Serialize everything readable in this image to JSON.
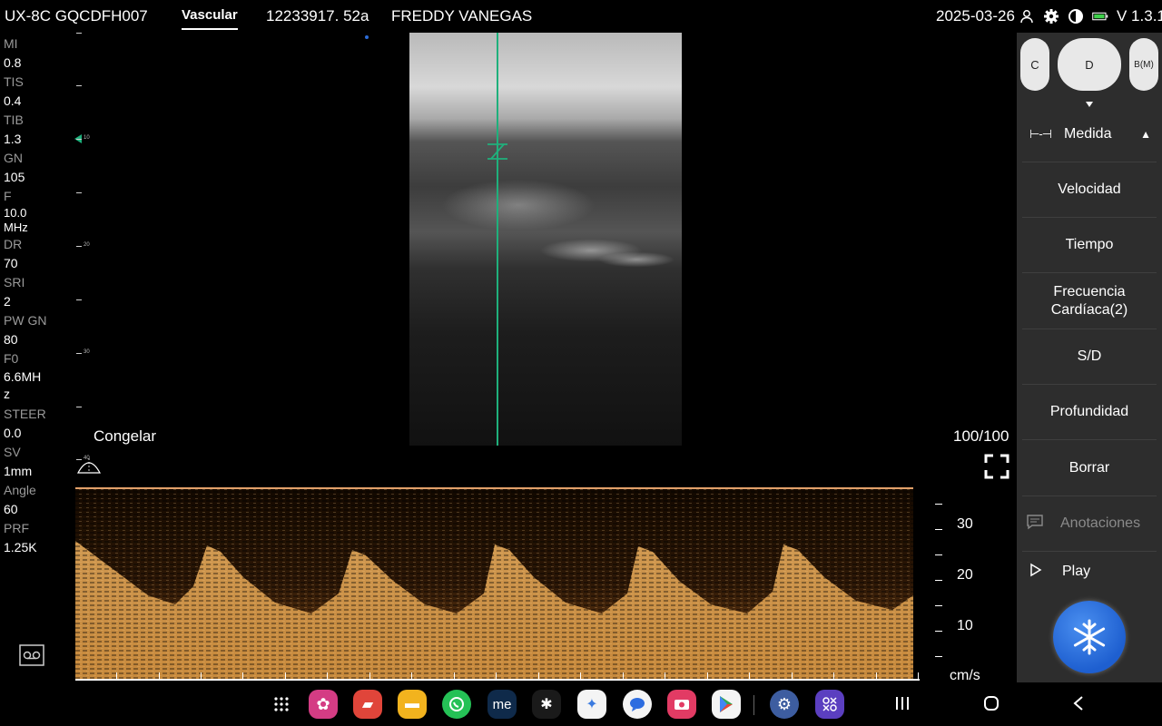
{
  "topbar": {
    "probe": "UX-8C GQCDFH007",
    "tab": "Vascular",
    "patient_id": "12233917. 52a",
    "patient_name": "FREDDY VANEGAS",
    "date": "2025-03-26",
    "version": "V 1.3.1"
  },
  "params": [
    {
      "label": "MI",
      "value": "0.8"
    },
    {
      "label": "TIS",
      "value": "0.4"
    },
    {
      "label": "TIB",
      "value": "1.3"
    },
    {
      "label": "GN",
      "value": "105"
    },
    {
      "label": "F",
      "value": "10.0\nMHz"
    },
    {
      "label": "DR",
      "value": "70"
    },
    {
      "label": "SRI",
      "value": "2"
    },
    {
      "label": "PW GN",
      "value": "80"
    },
    {
      "label": "F0",
      "value": "6.6MH\nz"
    },
    {
      "label": "STEER",
      "value": "0.0"
    },
    {
      "label": "SV",
      "value": "1mm"
    },
    {
      "label": "Angle",
      "value": "60"
    },
    {
      "label": "PRF",
      "value": "1.25K"
    }
  ],
  "depth_scale": [
    "10",
    "20",
    "30",
    "40"
  ],
  "image": {
    "freeze_label": "Congelar",
    "ratio": "100/100"
  },
  "doppler": {
    "velocity_labels": [
      "30",
      "20",
      "10"
    ],
    "unit": "cm/s"
  },
  "right_panel": {
    "modes": [
      "C",
      "D",
      "B(M)"
    ],
    "menu": [
      {
        "label": "Medida",
        "enabled": true
      },
      {
        "label": "Velocidad",
        "enabled": true
      },
      {
        "label": "Tiempo",
        "enabled": true
      },
      {
        "label": "Frecuencia Cardíaca(2)",
        "enabled": true
      },
      {
        "label": "S/D",
        "enabled": true
      },
      {
        "label": "Profundidad",
        "enabled": true
      },
      {
        "label": "Borrar",
        "enabled": true
      },
      {
        "label": "Anotaciones",
        "enabled": false
      },
      {
        "label": "Play",
        "enabled": true
      }
    ]
  },
  "navbar_apps": [
    "app-drawer-icon",
    "blossom-app-icon",
    "notes-app-icon",
    "files-app-icon",
    "whatsapp-icon",
    "me-app-icon",
    "tool-app-icon",
    "gemini-icon",
    "messages-icon",
    "camera-app-icon",
    "play-store-icon",
    "settings-icon",
    "apps-grid-icon"
  ],
  "colors": {
    "panel_bg": "#2d2d2d",
    "accent_line": "#1fb07c",
    "freeze_button": "#2a6fe0",
    "doppler_gold": "#c9924a"
  }
}
